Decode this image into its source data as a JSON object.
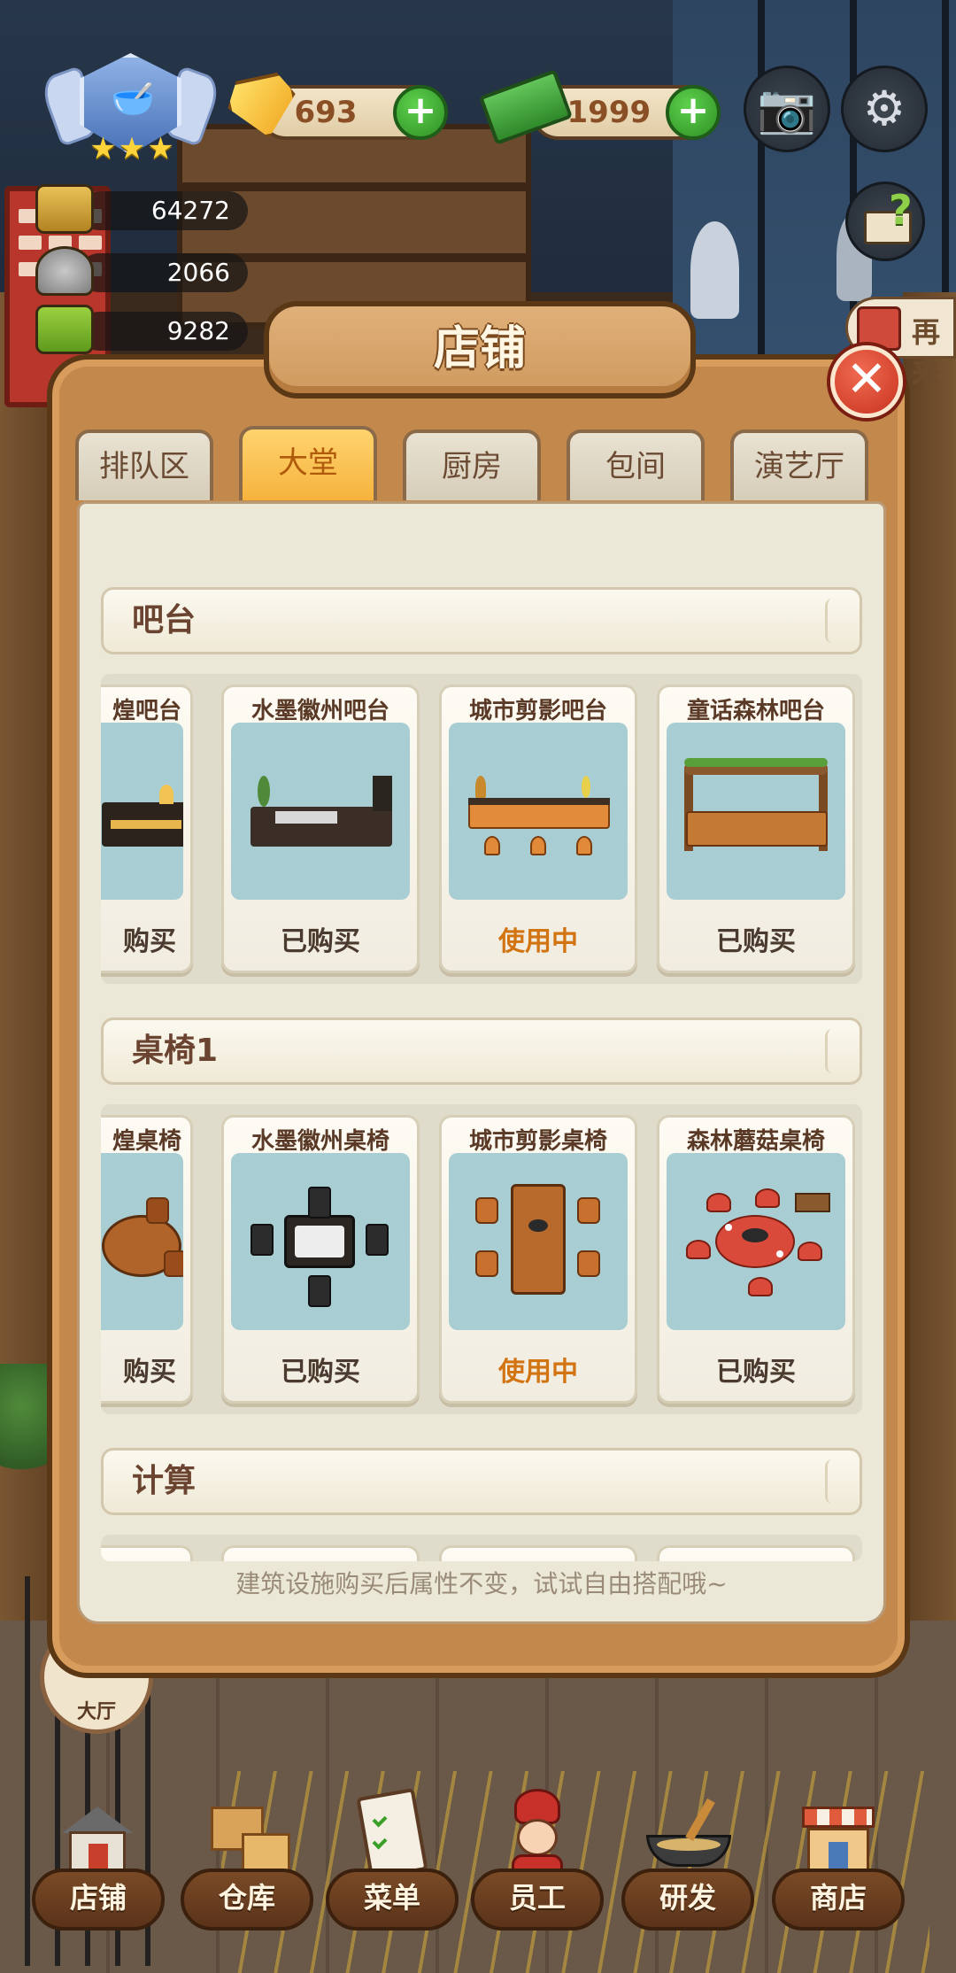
{
  "hud": {
    "gems": "693",
    "cash": "71999",
    "stats": [
      {
        "icon": "trophy-icon",
        "value": "64272"
      },
      {
        "icon": "dish-icon",
        "value": "2066"
      },
      {
        "icon": "menu-book-icon",
        "value": "9282"
      }
    ],
    "side_banner_text": "再来",
    "hall_label": "大厅"
  },
  "shop": {
    "title": "店铺",
    "tabs": [
      {
        "label": "排队区",
        "active": false
      },
      {
        "label": "大堂",
        "active": true
      },
      {
        "label": "厨房",
        "active": false
      },
      {
        "label": "包间",
        "active": false
      },
      {
        "label": "演艺厅",
        "active": false
      }
    ],
    "sections": [
      {
        "title": "吧台",
        "items": [
          {
            "name": "煌吧台",
            "status": "购买",
            "in_use": false
          },
          {
            "name": "水墨徽州吧台",
            "status": "已购买",
            "in_use": false
          },
          {
            "name": "城市剪影吧台",
            "status": "使用中",
            "in_use": true
          },
          {
            "name": "童话森林吧台",
            "status": "已购买",
            "in_use": false
          }
        ]
      },
      {
        "title": "桌椅1",
        "items": [
          {
            "name": "煌桌椅",
            "status": "购买",
            "in_use": false
          },
          {
            "name": "水墨徽州桌椅",
            "status": "已购买",
            "in_use": false
          },
          {
            "name": "城市剪影桌椅",
            "status": "使用中",
            "in_use": true
          },
          {
            "name": "森林蘑菇桌椅",
            "status": "已购买",
            "in_use": false
          }
        ]
      },
      {
        "title": "计算",
        "items": []
      }
    ],
    "footer_tip": "建筑设施购买后属性不变，试试自由搭配哦~"
  },
  "bottom_nav": [
    {
      "label": "店铺",
      "icon": "shop-house-icon"
    },
    {
      "label": "仓库",
      "icon": "boxes-icon"
    },
    {
      "label": "菜单",
      "icon": "clipboard-icon"
    },
    {
      "label": "员工",
      "icon": "chef-icon"
    },
    {
      "label": "研发",
      "icon": "wok-icon"
    },
    {
      "label": "商店",
      "icon": "store-icon"
    }
  ],
  "colors": {
    "panel_wood": "#c3884c",
    "tab_active": "#f6b33d",
    "in_use": "#d27412",
    "close": "#c8321e",
    "plus": "#2e8f24"
  }
}
